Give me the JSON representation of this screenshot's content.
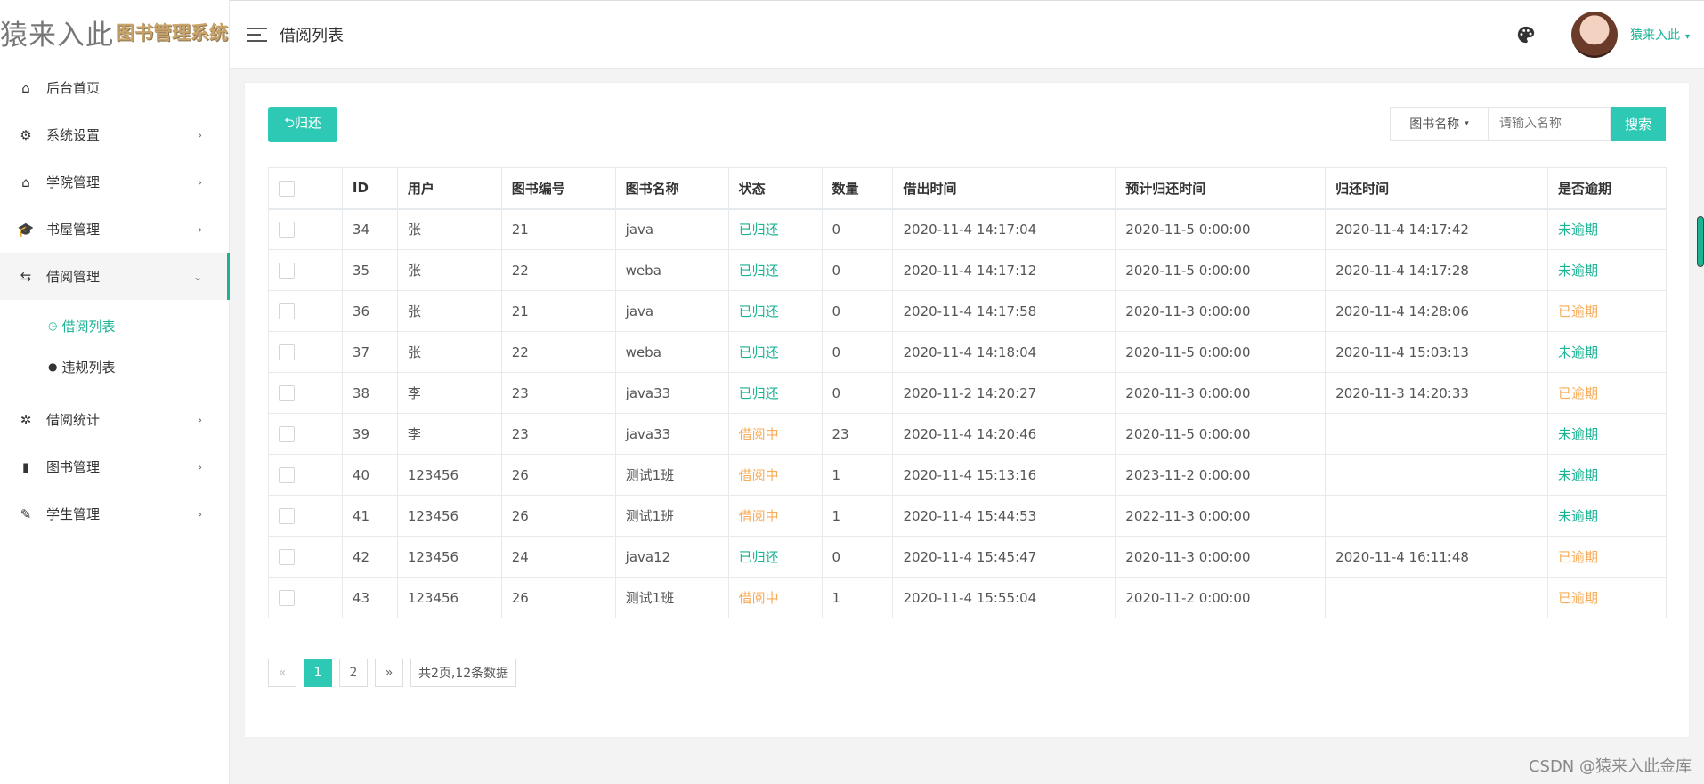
{
  "logo": {
    "main": "猿来入此",
    "sub": "图书管理系统"
  },
  "sidebar": {
    "items": [
      {
        "label": "后台首页",
        "icon": "home-icon",
        "glyph": "⌂",
        "has_children": false
      },
      {
        "label": "系统设置",
        "icon": "gear-icon",
        "glyph": "⚙",
        "has_children": true
      },
      {
        "label": "学院管理",
        "icon": "house-outline-icon",
        "glyph": "⌂",
        "has_children": true
      },
      {
        "label": "书屋管理",
        "icon": "graduation-cap-icon",
        "glyph": "🎓",
        "has_children": true
      },
      {
        "label": "借阅管理",
        "icon": "exchange-icon",
        "glyph": "⇆",
        "has_children": true,
        "expanded": true
      },
      {
        "label": "借阅统计",
        "icon": "aperture-icon",
        "glyph": "✲",
        "has_children": true
      },
      {
        "label": "图书管理",
        "icon": "clipboard-icon",
        "glyph": "▮",
        "has_children": true
      },
      {
        "label": "学生管理",
        "icon": "pencil-icon",
        "glyph": "✎",
        "has_children": true
      }
    ],
    "subitems": [
      {
        "label": "借阅列表",
        "icon": "history-icon",
        "glyph": "◷",
        "active": true
      },
      {
        "label": "违规列表",
        "icon": "exclamation-icon",
        "glyph": "●",
        "active": false
      }
    ],
    "chevron_right": "›",
    "chevron_down": "⌄"
  },
  "header": {
    "title": "借阅列表",
    "username": "猿来入此",
    "caret": "▾"
  },
  "toolbar": {
    "return_label": "⮌归还",
    "search_field": "图书名称",
    "search_caret": "▾",
    "search_placeholder": "请输入名称",
    "search_button": "搜索"
  },
  "table": {
    "headers": [
      "ID",
      "用户",
      "图书编号",
      "图书名称",
      "状态",
      "数量",
      "借出时间",
      "预计归还时间",
      "归还时间",
      "是否逾期"
    ],
    "rows": [
      {
        "id": "34",
        "user": "张",
        "book_no": "21",
        "book_name": "java",
        "status": "已归还",
        "qty": "0",
        "borrow_time": "2020-11-4 14:17:04",
        "due_time": "2020-11-5 0:00:00",
        "return_time": "2020-11-4 14:17:42",
        "overdue": "未逾期"
      },
      {
        "id": "35",
        "user": "张",
        "book_no": "22",
        "book_name": "weba",
        "status": "已归还",
        "qty": "0",
        "borrow_time": "2020-11-4 14:17:12",
        "due_time": "2020-11-5 0:00:00",
        "return_time": "2020-11-4 14:17:28",
        "overdue": "未逾期"
      },
      {
        "id": "36",
        "user": "张",
        "book_no": "21",
        "book_name": "java",
        "status": "已归还",
        "qty": "0",
        "borrow_time": "2020-11-4 14:17:58",
        "due_time": "2020-11-3 0:00:00",
        "return_time": "2020-11-4 14:28:06",
        "overdue": "已逾期"
      },
      {
        "id": "37",
        "user": "张",
        "book_no": "22",
        "book_name": "weba",
        "status": "已归还",
        "qty": "0",
        "borrow_time": "2020-11-4 14:18:04",
        "due_time": "2020-11-5 0:00:00",
        "return_time": "2020-11-4 15:03:13",
        "overdue": "未逾期"
      },
      {
        "id": "38",
        "user": "李",
        "book_no": "23",
        "book_name": "java33",
        "status": "已归还",
        "qty": "0",
        "borrow_time": "2020-11-2 14:20:27",
        "due_time": "2020-11-3 0:00:00",
        "return_time": "2020-11-3 14:20:33",
        "overdue": "已逾期"
      },
      {
        "id": "39",
        "user": "李",
        "book_no": "23",
        "book_name": "java33",
        "status": "借阅中",
        "qty": "23",
        "borrow_time": "2020-11-4 14:20:46",
        "due_time": "2020-11-5 0:00:00",
        "return_time": "",
        "overdue": "未逾期"
      },
      {
        "id": "40",
        "user": "123456",
        "book_no": "26",
        "book_name": "测试1班",
        "status": "借阅中",
        "qty": "1",
        "borrow_time": "2020-11-4 15:13:16",
        "due_time": "2023-11-2 0:00:00",
        "return_time": "",
        "overdue": "未逾期"
      },
      {
        "id": "41",
        "user": "123456",
        "book_no": "26",
        "book_name": "测试1班",
        "status": "借阅中",
        "qty": "1",
        "borrow_time": "2020-11-4 15:44:53",
        "due_time": "2022-11-3 0:00:00",
        "return_time": "",
        "overdue": "未逾期"
      },
      {
        "id": "42",
        "user": "123456",
        "book_no": "24",
        "book_name": "java12",
        "status": "已归还",
        "qty": "0",
        "borrow_time": "2020-11-4 15:45:47",
        "due_time": "2020-11-3 0:00:00",
        "return_time": "2020-11-4 16:11:48",
        "overdue": "已逾期"
      },
      {
        "id": "43",
        "user": "123456",
        "book_no": "26",
        "book_name": "测试1班",
        "status": "借阅中",
        "qty": "1",
        "borrow_time": "2020-11-4 15:55:04",
        "due_time": "2020-11-2 0:00:00",
        "return_time": "",
        "overdue": "已逾期"
      }
    ]
  },
  "pagination": {
    "prev": "«",
    "pages": [
      "1",
      "2"
    ],
    "current": "1",
    "next": "»",
    "info": "共2页,12条数据"
  },
  "watermark": "CSDN @猿来入此金库",
  "colors": {
    "accent": "#2ec9b5",
    "green": "#1ab394",
    "orange": "#f8ac59"
  }
}
